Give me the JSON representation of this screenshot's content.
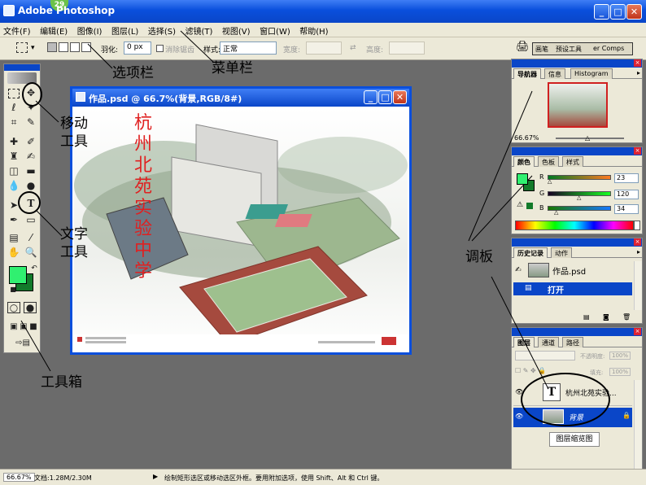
{
  "app": {
    "title": "Adobe Photoshop",
    "badge": "29"
  },
  "menu": [
    "文件(F)",
    "编辑(E)",
    "图像(I)",
    "图层(L)",
    "选择(S)",
    "滤镜(T)",
    "视图(V)",
    "窗口(W)",
    "帮助(H)"
  ],
  "options": {
    "feather_label": "羽化:",
    "feather_value": "0 px",
    "antialias_label": "消除锯齿",
    "style_label": "样式:",
    "style_value": "正常",
    "width_label": "宽度:",
    "height_label": "高度:",
    "palette_tabs": [
      "画笔",
      "预设工具",
      "er Comps"
    ]
  },
  "document": {
    "title": "作品.psd @ 66.7%(背景,RGB/8#)",
    "vertical_text": [
      "杭",
      "州",
      "北",
      "苑",
      "实",
      "验",
      "中",
      "学"
    ]
  },
  "navigator": {
    "tabs": [
      "导航器",
      "信息",
      "Histogram"
    ],
    "zoom": "66.67%"
  },
  "color_panel": {
    "tabs": [
      "颜色",
      "色板",
      "样式"
    ],
    "channels": [
      {
        "label": "R",
        "value": "23"
      },
      {
        "label": "G",
        "value": "120"
      },
      {
        "label": "B",
        "value": "34"
      }
    ]
  },
  "history_panel": {
    "tabs": [
      "历史记录",
      "动作"
    ],
    "snapshot_label": "作品.psd",
    "step_label": "打开"
  },
  "layers_panel": {
    "tabs": [
      "图层",
      "通道",
      "路径"
    ],
    "opacity_label": "不透明度:",
    "opacity_value": "100%",
    "fill_label": "填充:",
    "fill_value": "100%",
    "layers": [
      {
        "name": "杭州北苑实验...",
        "thumb": "T"
      },
      {
        "name": "背景",
        "thumb": ""
      }
    ],
    "thumbnail_caption": "图层缩览图"
  },
  "status": {
    "zoom": "66.67%",
    "doc_info": "文档:1.28M/2.30M",
    "hint": "绘制矩形选区或移动选区外框。要用附加选项，使用 Shift、Alt 和 Ctrl 键。"
  },
  "annotations": {
    "options_bar": "选项栏",
    "menu_bar": "菜单栏",
    "move_tool_1": "移动",
    "move_tool_2": "工具",
    "text_tool_1": "文字",
    "text_tool_2": "工具",
    "toolbox": "工具箱",
    "palettes": "调板"
  },
  "colors": {
    "foreground": "#30f070",
    "background": "#127a2a",
    "accent": "#0a46c8"
  }
}
